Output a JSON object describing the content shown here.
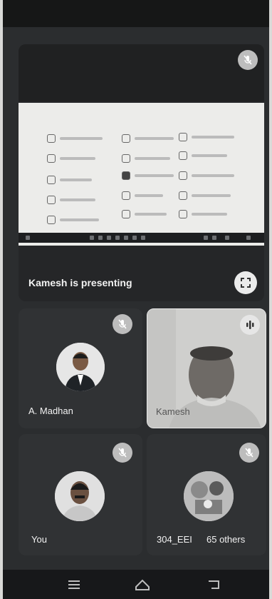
{
  "presentation": {
    "presenting_label": "Kamesh is presenting"
  },
  "participants": [
    {
      "name": "A. Madhan",
      "muted": true
    },
    {
      "name": "Kamesh",
      "speaking": true
    },
    {
      "name": "You",
      "muted": true
    },
    {
      "name": "304_EEI",
      "others_label": "65 others",
      "muted": true
    }
  ],
  "icons": {
    "mute": "mic-off-icon",
    "fullscreen": "fullscreen-icon",
    "speaking": "audio-bars-icon",
    "nav_menu": "menu-icon",
    "nav_home": "home-icon",
    "nav_back": "back-icon"
  },
  "colors": {
    "background": "#2b2d2f",
    "tile": "#303234",
    "text": "#f2f2f2"
  }
}
